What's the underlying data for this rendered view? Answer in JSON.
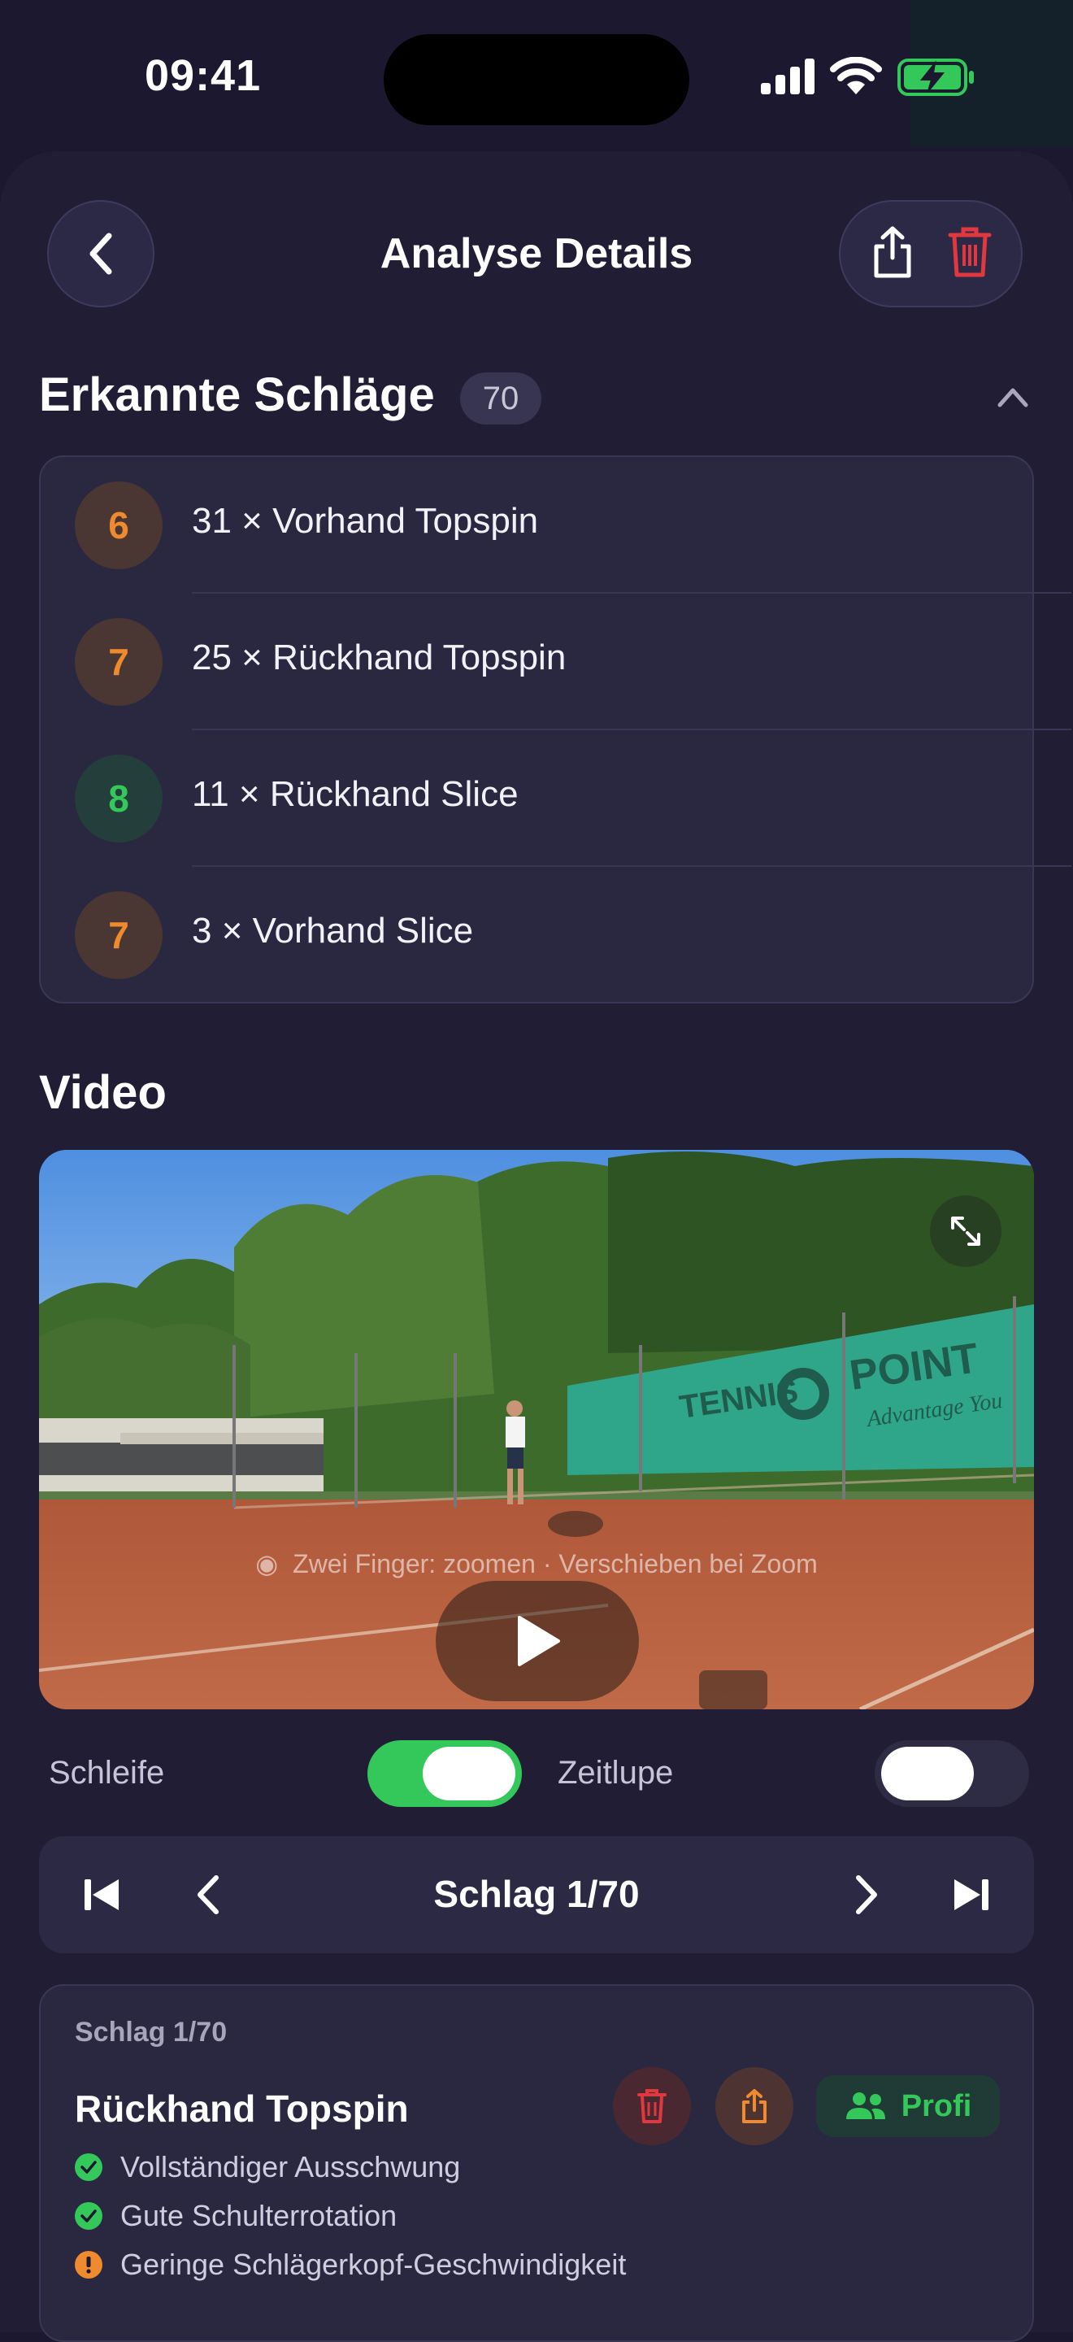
{
  "status_bar": {
    "time": "09:41"
  },
  "header": {
    "title": "Analyse Details"
  },
  "strokes_section": {
    "title": "Erkannte Schläge",
    "count": "70",
    "items": [
      {
        "score": "6",
        "label": "31 × Vorhand Topspin",
        "tone": "orange"
      },
      {
        "score": "7",
        "label": "25 × Rückhand Topspin",
        "tone": "orange"
      },
      {
        "score": "8",
        "label": "11 × Rückhand Slice",
        "tone": "green"
      },
      {
        "score": "7",
        "label": "3 × Vorhand Slice",
        "tone": "orange"
      }
    ]
  },
  "video_section": {
    "title": "Video",
    "zoom_hint": "Zwei Finger: zoomen · Verschieben bei Zoom",
    "loop_label": "Schleife",
    "loop_on": true,
    "slowmo_label": "Zeitlupe",
    "slowmo_on": false
  },
  "stroke_nav": {
    "title": "Schlag 1/70"
  },
  "stroke_detail": {
    "subtitle": "Schlag 1/70",
    "title": "Rückhand Topspin",
    "profi_label": "Profi",
    "feedback": [
      {
        "text": "Vollständiger Ausschwung",
        "status": "good"
      },
      {
        "text": "Gute Schulterrotation",
        "status": "good"
      },
      {
        "text": "Geringe Schlägerkopf-Geschwindigkeit",
        "status": "warn"
      }
    ]
  },
  "colors": {
    "accent_green": "#34c759",
    "accent_orange": "#f08a2e",
    "danger_red": "#e0383e"
  }
}
